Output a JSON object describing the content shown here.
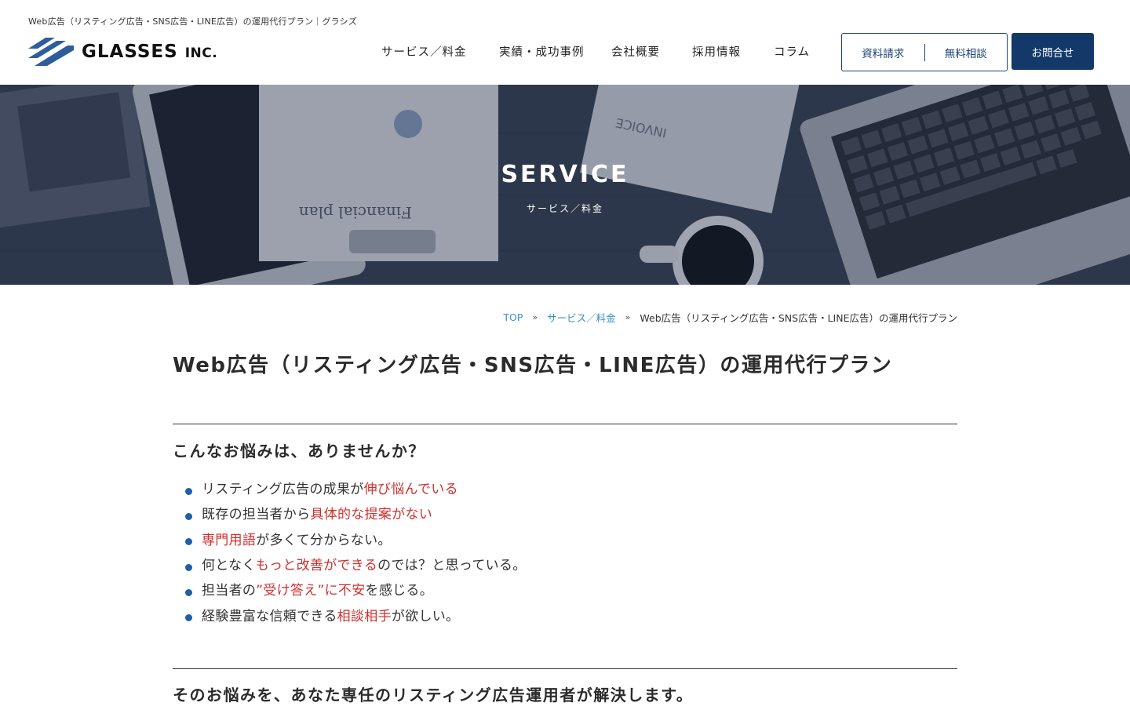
{
  "header": {
    "tagline": "Web広告（リスティング広告・SNS広告・LINE広告）の運用代行プラン｜グラシズ",
    "logo_text": "GLASSES",
    "logo_suffix": "INC.",
    "nav": [
      {
        "label": "サービス／料金"
      },
      {
        "label": "実績・成功事例"
      },
      {
        "label": "会社概要"
      },
      {
        "label": "採用情報"
      },
      {
        "label": "コラム"
      }
    ],
    "cta_document": "資料請求",
    "cta_consult": "無料相談",
    "contact_button": "お問合せ"
  },
  "hero": {
    "title": "SERVICE",
    "subtitle": "サービス／料金"
  },
  "breadcrumb": {
    "items": [
      "TOP",
      "サービス／料金"
    ],
    "separator": "»",
    "current": "Web広告（リスティング広告・SNS広告・LINE広告）の運用代行プラン"
  },
  "main": {
    "page_title": "Web広告（リスティング広告・SNS広告・LINE広告）の運用代行プラン",
    "section1_heading": "こんなお悩みは、ありませんか？",
    "problems": [
      {
        "pre": "リスティング広告の成果が",
        "hl": "伸び悩んでいる",
        "post": ""
      },
      {
        "pre": "既存の担当者から",
        "hl": "具体的な提案がない",
        "post": ""
      },
      {
        "pre": "",
        "hl": "専門用語",
        "post": "が多くて分からない。"
      },
      {
        "pre": "何となく",
        "hl": "もっと改善ができる",
        "post": "のでは？と思っている。"
      },
      {
        "pre": "担当者の",
        "hl": "”受け答え”に不安",
        "post": "を感じる。"
      },
      {
        "pre": "経験豊富な信頼できる",
        "hl": "相談相手",
        "post": "が欲しい。"
      }
    ],
    "section2_heading": "そのお悩みを、あなた専任のリスティング広告運用者が解決します。"
  },
  "colors": {
    "primary": "#13396a",
    "link": "#3a8fc7",
    "highlight": "#d0302e",
    "bullet": "#1f5fa8"
  }
}
